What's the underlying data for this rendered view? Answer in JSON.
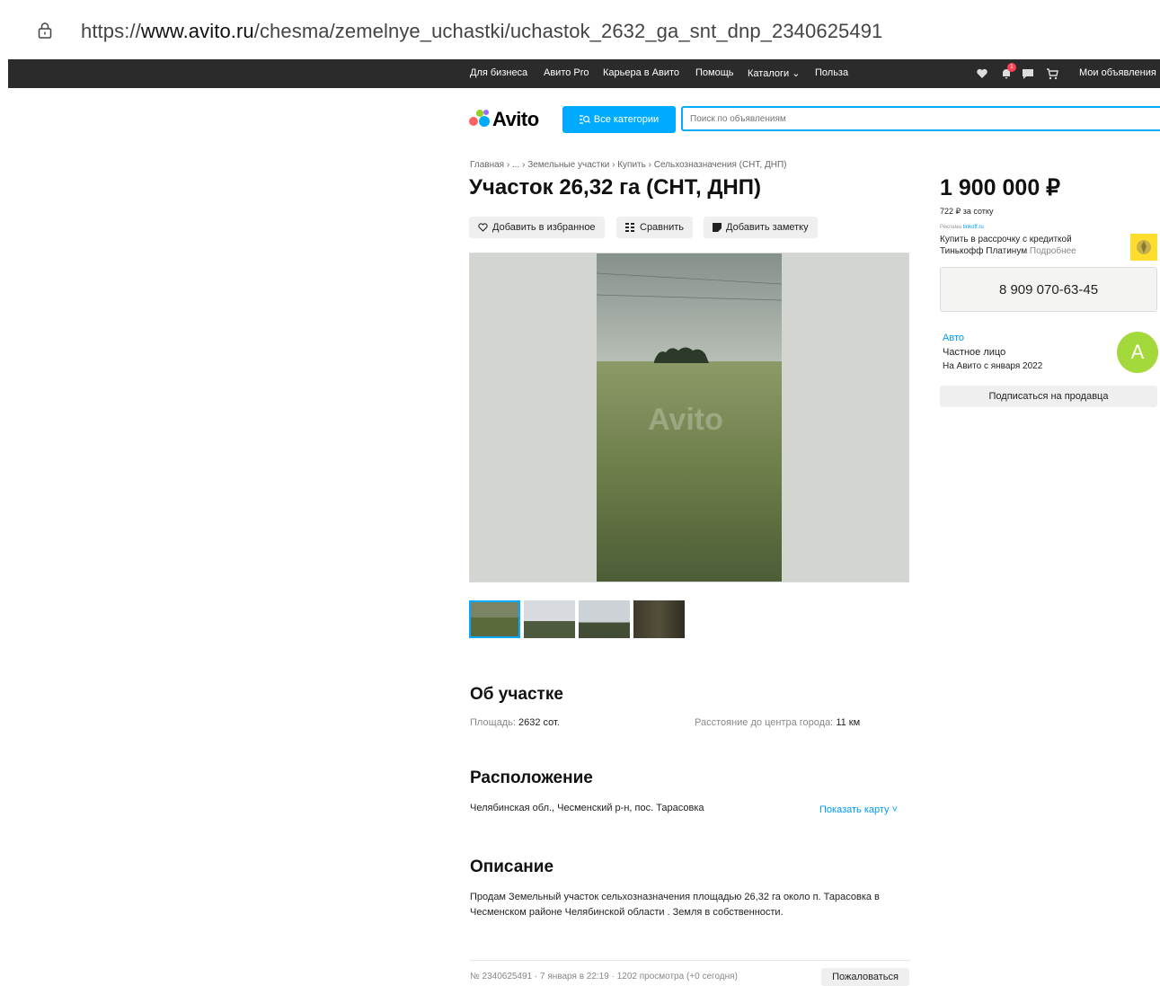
{
  "browser": {
    "url_prefix": "https://",
    "url_host": "www.avito.ru",
    "url_path": "/chesma/zemelnye_uchastki/uchastok_2632_ga_snt_dnp_2340625491"
  },
  "topnav": {
    "items": [
      "Для бизнеса",
      "Авито Pro",
      "Карьера в Авито",
      "Помощь",
      "Каталоги",
      "Польза"
    ],
    "my_ads": "Мои объявления",
    "notification_count": "1"
  },
  "header": {
    "logo": "Avito",
    "categories_button": "Все категории",
    "search_placeholder": "Поиск по объявлениям"
  },
  "breadcrumbs": [
    "Главная",
    "...",
    "Земельные участки",
    "Купить",
    "Сельхозназначения (СНТ, ДНП)"
  ],
  "listing": {
    "title": "Участок 26,32 га (СНТ, ДНП)",
    "actions": {
      "favorite": "Добавить в избранное",
      "compare": "Сравнить",
      "note": "Добавить заметку"
    },
    "photo_watermark": "Avito",
    "thumbnail_count": 4
  },
  "sidebar": {
    "price": "1 900 000 ₽",
    "price_per_unit": "722 ₽ за сотку",
    "ad_label": "Реклама",
    "ad_source": "tinkoff.ru",
    "ad_text_line1": "Купить в рассрочку с кредиткой",
    "ad_text_line2": "Тинькофф Платинум",
    "ad_more": "Подробнее",
    "phone": "8 909 070-63-45",
    "seller_name": "Авто",
    "seller_type": "Частное лицо",
    "seller_since": "На Авито с января 2022",
    "avatar_letter": "A",
    "subscribe_button": "Подписаться на продавца"
  },
  "about": {
    "heading": "Об участке",
    "area_label": "Площадь:",
    "area_value": "2632 сот.",
    "distance_label": "Расстояние до центра города:",
    "distance_value": "11 км"
  },
  "location": {
    "heading": "Расположение",
    "address": "Челябинская обл., Чесменский р-н, пос. Тарасовка",
    "show_map": "Показать карту"
  },
  "description": {
    "heading": "Описание",
    "text": "Продам Земельный участок сельхозназначения площадью 26,32 га около п. Тарасовка в Чесменском районе Челябинской области . Земля в собственности."
  },
  "footer": {
    "meta": "№ 2340625491 · 7 января в 22:19 · 1202 просмотра (+0 сегодня)",
    "complain_button": "Пожаловаться"
  },
  "colors": {
    "accent": "#00aaff",
    "nav_bg": "#2b2b2b",
    "avatar": "#a4d93b"
  }
}
